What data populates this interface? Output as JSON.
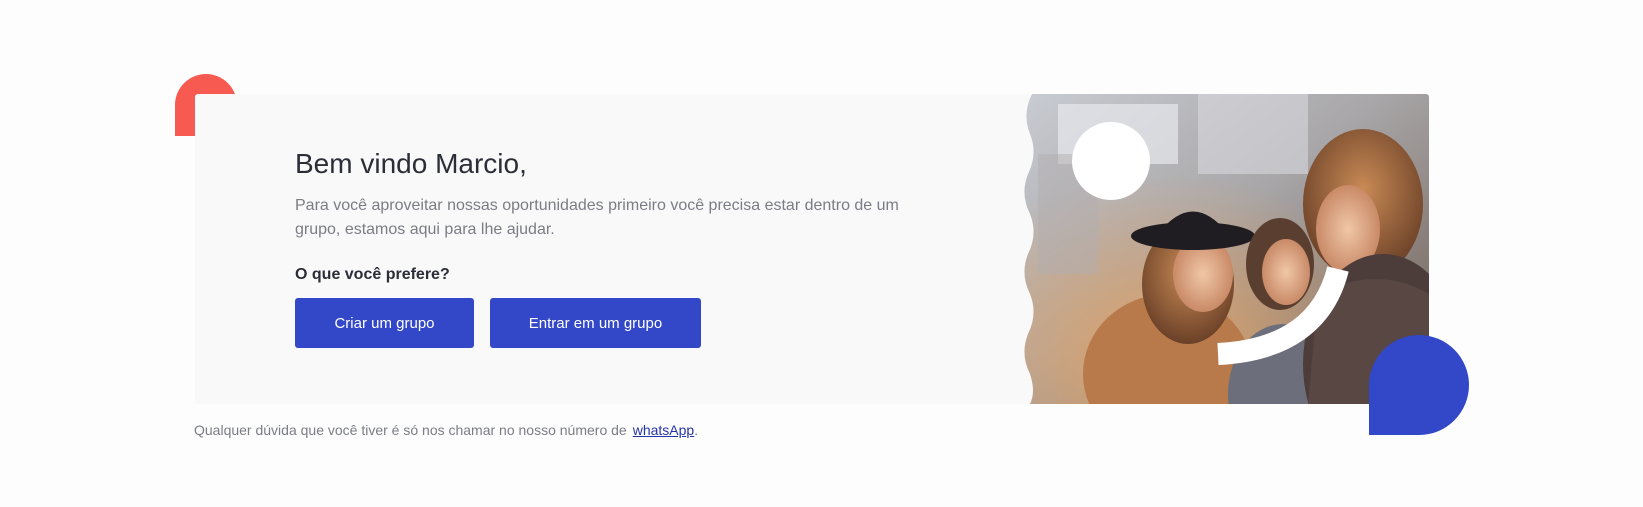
{
  "welcome": {
    "title": "Bem vindo Marcio,",
    "description": "Para você aproveitar nossas oportunidades primeiro você precisa estar dentro de um grupo, estamos aqui para lhe ajudar.",
    "question": "O que você prefere?"
  },
  "actions": {
    "create_label": "Criar um grupo",
    "join_label": "Entrar em um grupo"
  },
  "footer": {
    "text": "Qualquer dúvida que você tiver é só nos chamar no nosso número de",
    "link_label": "whatsApp",
    "suffix": "."
  },
  "colors": {
    "primary": "#3248c8",
    "accent_red": "#f65a50",
    "card_bg": "#f9f9fa"
  },
  "image": {
    "icon": "group-photo"
  }
}
